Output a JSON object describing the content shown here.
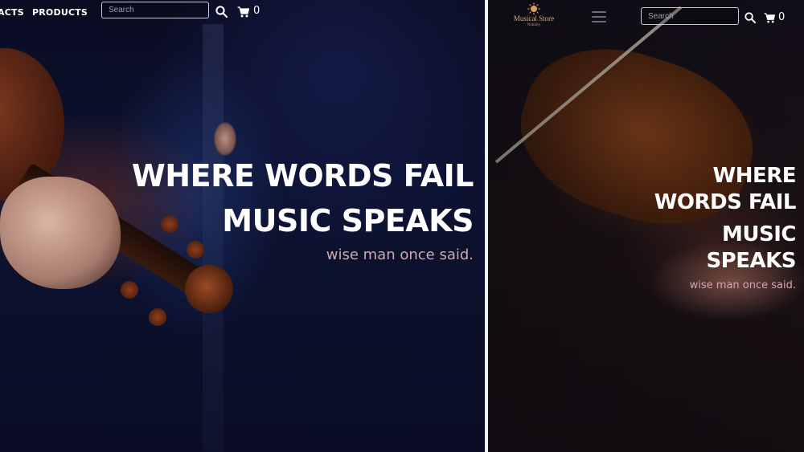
{
  "nav": {
    "links": [
      "ACTS",
      "PRODUCTS"
    ]
  },
  "search": {
    "placeholder": "Search"
  },
  "cart": {
    "count": "0"
  },
  "hero": {
    "line1": "WHERE WORDS FAIL",
    "line2": "MUSIC SPEAKS",
    "tagline": "wise man once said."
  },
  "mobile": {
    "logo_name": "Musical Store",
    "logo_sub": "Nobility",
    "hero_lines": [
      "WHERE",
      "WORDS FAIL",
      "MUSIC",
      "SPEAKS"
    ],
    "tagline": "wise man once said."
  },
  "icons": {
    "search": "search-icon",
    "cart": "cart-icon",
    "menu": "hamburger-menu-icon",
    "logo": "sun-logo-icon"
  },
  "colors": {
    "hero_text": "#ffffff",
    "tagline": "#d2a7b4",
    "logo": "#d6b07a"
  }
}
